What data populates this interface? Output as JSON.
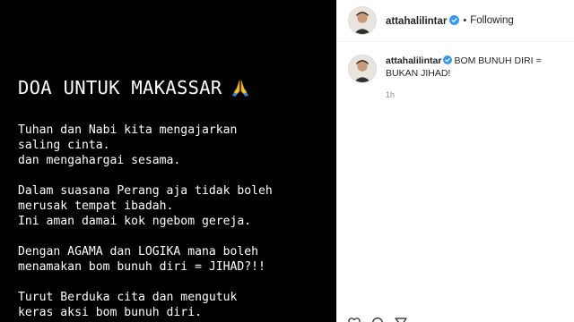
{
  "post": {
    "heading": "DOA UNTUK MAKASSAR",
    "heading_icon": "folded-hands-emoji",
    "paragraphs": [
      [
        "Tuhan dan Nabi kita mengajarkan",
        "saling cinta.",
        "dan mengahargai sesama."
      ],
      [
        "Dalam suasana Perang aja tidak boleh",
        "merusak tempat ibadah.",
        "Ini aman damai kok ngebom gereja."
      ],
      [
        "Dengan AGAMA dan LOGIKA mana boleh",
        "menamakan bom bunuh diri = JIHAD?!!"
      ],
      [
        "Turut Berduka cita dan mengutuk",
        "keras aksi bom bunuh diri."
      ]
    ]
  },
  "header": {
    "username": "attahalilintar",
    "separator": "•",
    "follow_status": "Following"
  },
  "caption": {
    "username": "attahalilintar",
    "text": "BOM BUNUH DIRI = BUKAN JIHAD!",
    "timestamp": "1h"
  },
  "colors": {
    "verified": "#3897f0",
    "text": "#262626",
    "muted": "#8e8e8e"
  }
}
